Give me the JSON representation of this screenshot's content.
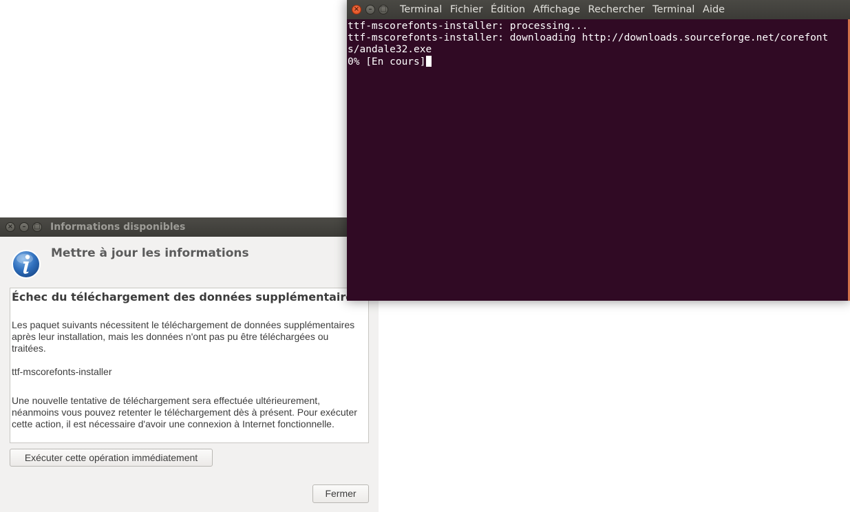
{
  "dialog": {
    "window_title": "Informations disponibles",
    "header": "Mettre à jour les informations",
    "message_heading": "Échec du téléchargement des données supplémentaires",
    "paragraph1": "Les paquet suivants nécessitent le téléchargement de données supplémentaires après leur installation, mais les données n'ont pas pu être téléchargées ou traitées.",
    "package_name": "ttf-mscorefonts-installer",
    "paragraph3": "Une nouvelle tentative de téléchargement sera effectuée ultérieurement, néanmoins vous pouvez retenter le téléchargement dès à présent. Pour exécuter cette action, il est nécessaire d'avoir une connexion à Internet fonctionnelle.",
    "retry_button": "Exécuter cette opération immédiatement",
    "close_button": "Fermer",
    "icon": "info-icon"
  },
  "terminal": {
    "menu": [
      "Terminal",
      "Fichier",
      "Édition",
      "Affichage",
      "Rechercher",
      "Terminal",
      "Aide"
    ],
    "lines": [
      "ttf-mscorefonts-installer: processing...",
      "ttf-mscorefonts-installer: downloading http://downloads.sourceforge.net/corefont",
      "s/andale32.exe",
      "0% [En cours]"
    ],
    "background": "#300a24",
    "foreground": "#ffffff"
  },
  "window_controls": {
    "close_glyph": "×",
    "minimize_glyph": "–",
    "maximize_glyph": "□"
  }
}
